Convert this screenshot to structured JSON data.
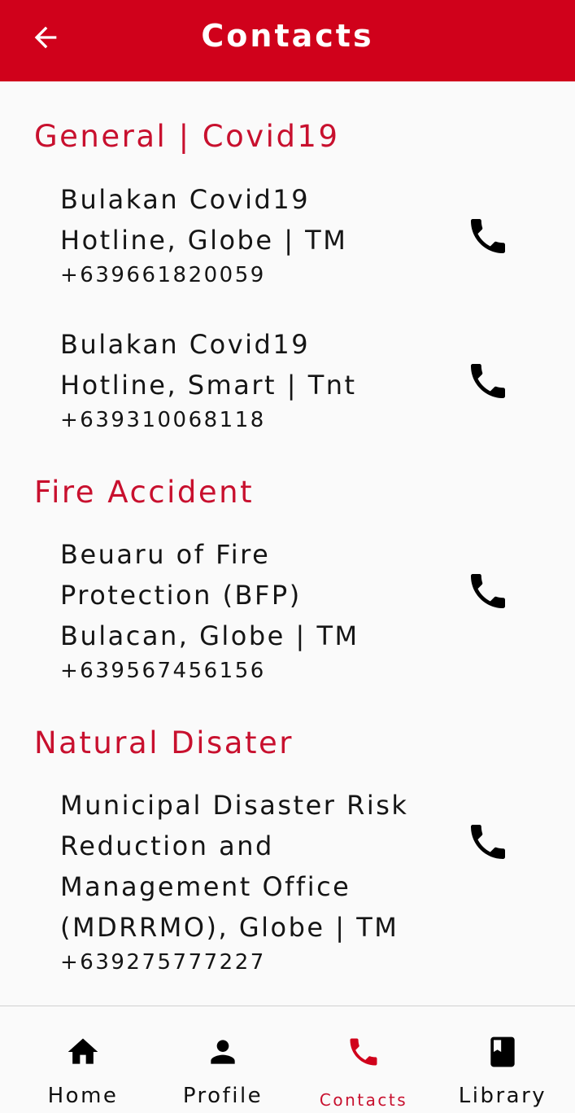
{
  "appbar": {
    "title": "Contacts",
    "back_icon": "arrow-back-icon"
  },
  "sections": [
    {
      "title": "General | Covid19",
      "contacts": [
        {
          "name": "Bulakan Covid19 Hotline, Globe | TM",
          "number": "+639661820059",
          "icon": "phone-icon"
        },
        {
          "name": "Bulakan Covid19 Hotline, Smart | Tnt",
          "number": "+639310068118",
          "icon": "phone-icon"
        }
      ]
    },
    {
      "title": "Fire Accident",
      "contacts": [
        {
          "name": "Beuaru of Fire Protection (BFP) Bulacan, Globe | TM",
          "number": "+639567456156",
          "icon": "phone-icon"
        }
      ]
    },
    {
      "title": "Natural Disater",
      "contacts": [
        {
          "name": "Municipal Disaster Risk Reduction and Management Office (MDRRMO), Globe | TM",
          "number": "+639275777227",
          "icon": "phone-icon"
        }
      ]
    }
  ],
  "bottom_nav": {
    "items": [
      {
        "label": "Home",
        "icon": "home-icon"
      },
      {
        "label": "Profile",
        "icon": "person-icon"
      },
      {
        "label": "Contacts",
        "icon": "phone-icon",
        "active": true
      },
      {
        "label": "Library",
        "icon": "bookmark-book-icon"
      }
    ]
  },
  "colors": {
    "accent": "#d0011b",
    "section_title": "#c8102e",
    "text": "#151515",
    "background": "#fafafa"
  }
}
